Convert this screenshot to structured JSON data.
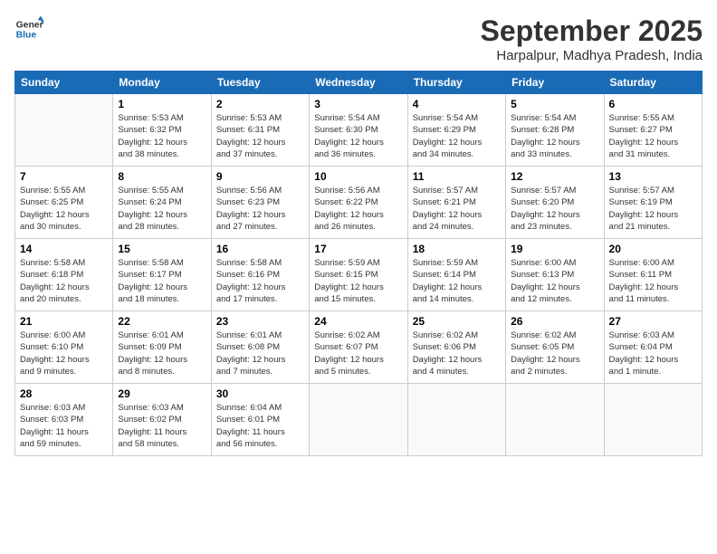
{
  "logo": {
    "line1": "General",
    "line2": "Blue"
  },
  "title": "September 2025",
  "subtitle": "Harpalpur, Madhya Pradesh, India",
  "days_of_week": [
    "Sunday",
    "Monday",
    "Tuesday",
    "Wednesday",
    "Thursday",
    "Friday",
    "Saturday"
  ],
  "weeks": [
    [
      {
        "day": "",
        "content": ""
      },
      {
        "day": "1",
        "content": "Sunrise: 5:53 AM\nSunset: 6:32 PM\nDaylight: 12 hours\nand 38 minutes."
      },
      {
        "day": "2",
        "content": "Sunrise: 5:53 AM\nSunset: 6:31 PM\nDaylight: 12 hours\nand 37 minutes."
      },
      {
        "day": "3",
        "content": "Sunrise: 5:54 AM\nSunset: 6:30 PM\nDaylight: 12 hours\nand 36 minutes."
      },
      {
        "day": "4",
        "content": "Sunrise: 5:54 AM\nSunset: 6:29 PM\nDaylight: 12 hours\nand 34 minutes."
      },
      {
        "day": "5",
        "content": "Sunrise: 5:54 AM\nSunset: 6:28 PM\nDaylight: 12 hours\nand 33 minutes."
      },
      {
        "day": "6",
        "content": "Sunrise: 5:55 AM\nSunset: 6:27 PM\nDaylight: 12 hours\nand 31 minutes."
      }
    ],
    [
      {
        "day": "7",
        "content": "Sunrise: 5:55 AM\nSunset: 6:25 PM\nDaylight: 12 hours\nand 30 minutes."
      },
      {
        "day": "8",
        "content": "Sunrise: 5:55 AM\nSunset: 6:24 PM\nDaylight: 12 hours\nand 28 minutes."
      },
      {
        "day": "9",
        "content": "Sunrise: 5:56 AM\nSunset: 6:23 PM\nDaylight: 12 hours\nand 27 minutes."
      },
      {
        "day": "10",
        "content": "Sunrise: 5:56 AM\nSunset: 6:22 PM\nDaylight: 12 hours\nand 26 minutes."
      },
      {
        "day": "11",
        "content": "Sunrise: 5:57 AM\nSunset: 6:21 PM\nDaylight: 12 hours\nand 24 minutes."
      },
      {
        "day": "12",
        "content": "Sunrise: 5:57 AM\nSunset: 6:20 PM\nDaylight: 12 hours\nand 23 minutes."
      },
      {
        "day": "13",
        "content": "Sunrise: 5:57 AM\nSunset: 6:19 PM\nDaylight: 12 hours\nand 21 minutes."
      }
    ],
    [
      {
        "day": "14",
        "content": "Sunrise: 5:58 AM\nSunset: 6:18 PM\nDaylight: 12 hours\nand 20 minutes."
      },
      {
        "day": "15",
        "content": "Sunrise: 5:58 AM\nSunset: 6:17 PM\nDaylight: 12 hours\nand 18 minutes."
      },
      {
        "day": "16",
        "content": "Sunrise: 5:58 AM\nSunset: 6:16 PM\nDaylight: 12 hours\nand 17 minutes."
      },
      {
        "day": "17",
        "content": "Sunrise: 5:59 AM\nSunset: 6:15 PM\nDaylight: 12 hours\nand 15 minutes."
      },
      {
        "day": "18",
        "content": "Sunrise: 5:59 AM\nSunset: 6:14 PM\nDaylight: 12 hours\nand 14 minutes."
      },
      {
        "day": "19",
        "content": "Sunrise: 6:00 AM\nSunset: 6:13 PM\nDaylight: 12 hours\nand 12 minutes."
      },
      {
        "day": "20",
        "content": "Sunrise: 6:00 AM\nSunset: 6:11 PM\nDaylight: 12 hours\nand 11 minutes."
      }
    ],
    [
      {
        "day": "21",
        "content": "Sunrise: 6:00 AM\nSunset: 6:10 PM\nDaylight: 12 hours\nand 9 minutes."
      },
      {
        "day": "22",
        "content": "Sunrise: 6:01 AM\nSunset: 6:09 PM\nDaylight: 12 hours\nand 8 minutes."
      },
      {
        "day": "23",
        "content": "Sunrise: 6:01 AM\nSunset: 6:08 PM\nDaylight: 12 hours\nand 7 minutes."
      },
      {
        "day": "24",
        "content": "Sunrise: 6:02 AM\nSunset: 6:07 PM\nDaylight: 12 hours\nand 5 minutes."
      },
      {
        "day": "25",
        "content": "Sunrise: 6:02 AM\nSunset: 6:06 PM\nDaylight: 12 hours\nand 4 minutes."
      },
      {
        "day": "26",
        "content": "Sunrise: 6:02 AM\nSunset: 6:05 PM\nDaylight: 12 hours\nand 2 minutes."
      },
      {
        "day": "27",
        "content": "Sunrise: 6:03 AM\nSunset: 6:04 PM\nDaylight: 12 hours\nand 1 minute."
      }
    ],
    [
      {
        "day": "28",
        "content": "Sunrise: 6:03 AM\nSunset: 6:03 PM\nDaylight: 11 hours\nand 59 minutes."
      },
      {
        "day": "29",
        "content": "Sunrise: 6:03 AM\nSunset: 6:02 PM\nDaylight: 11 hours\nand 58 minutes."
      },
      {
        "day": "30",
        "content": "Sunrise: 6:04 AM\nSunset: 6:01 PM\nDaylight: 11 hours\nand 56 minutes."
      },
      {
        "day": "",
        "content": ""
      },
      {
        "day": "",
        "content": ""
      },
      {
        "day": "",
        "content": ""
      },
      {
        "day": "",
        "content": ""
      }
    ]
  ]
}
